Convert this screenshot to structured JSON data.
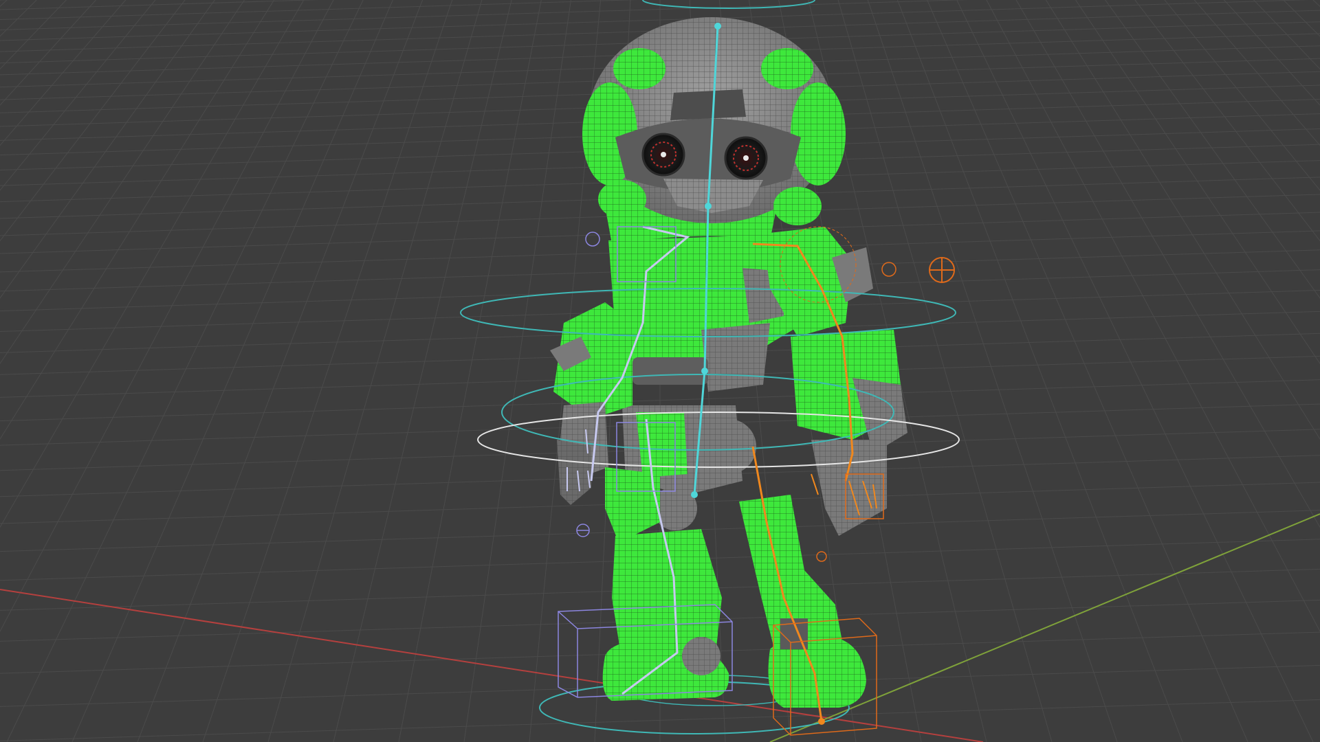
{
  "viewport": {
    "mode": "3d-viewport",
    "background_color": "#3d3d3d",
    "grid_color": "#4b4b4b",
    "x_axis_color": "#b5403e",
    "y_axis_color": "#7fa23a"
  },
  "character": {
    "name_shown": "",
    "mesh_primary_color": "#3ee83c",
    "mesh_secondary_color": "#8a8a8a",
    "wireframe_overlay": true
  },
  "rig": {
    "spine_bone_color": "#4fd6d9",
    "left_chain_color": "#c7c9f0",
    "right_chain_color": "#f0881e",
    "control_ring_color": "#3fb8b6",
    "root_ring_color": "#e6e6e6",
    "ik_box_left_color": "#8c86e0",
    "ik_box_right_color": "#e06a1a"
  },
  "icons": {
    "pole_target_left": "pole-target-icon",
    "pole_target_right": "pole-target-icon"
  }
}
